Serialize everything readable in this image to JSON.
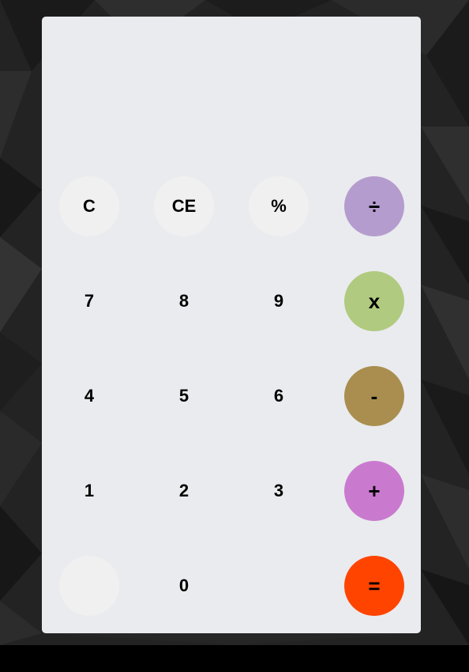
{
  "display": {
    "value": ""
  },
  "keys": {
    "clear": "C",
    "clear_entry": "CE",
    "percent": "%",
    "divide": "÷",
    "seven": "7",
    "eight": "8",
    "nine": "9",
    "multiply": "x",
    "four": "4",
    "five": "5",
    "six": "6",
    "subtract": "-",
    "one": "1",
    "two": "2",
    "three": "3",
    "add": "+",
    "zero": "0",
    "equals": "="
  },
  "colors": {
    "divide": "#b59cce",
    "multiply": "#b0ca80",
    "subtract": "#a98e4f",
    "add": "#c97acf",
    "equals": "#ff4400",
    "panel": "#eaebee",
    "function_key": "#f0f0f0"
  }
}
